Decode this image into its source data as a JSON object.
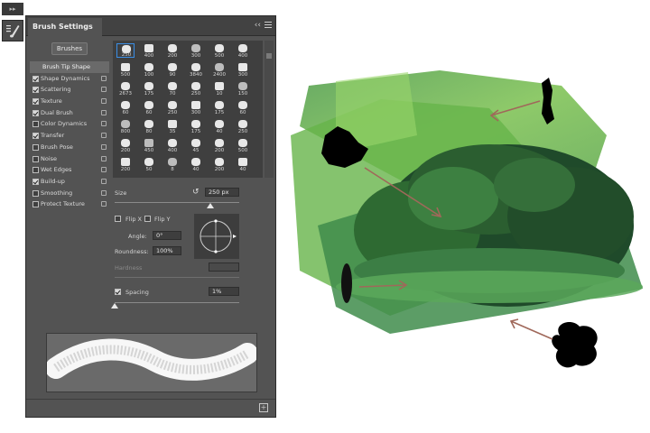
{
  "toolstrip": {
    "top_label": "▸▸",
    "brush_icon": "brush-settings-icon"
  },
  "panel": {
    "title": "Brush Settings",
    "collapse_label": "‹‹",
    "brushes_button": "Brushes"
  },
  "options": [
    {
      "label": "Brush Tip Shape",
      "checked": null,
      "lock": false,
      "head": true
    },
    {
      "label": "Shape Dynamics",
      "checked": true,
      "lock": true
    },
    {
      "label": "Scattering",
      "checked": true,
      "lock": true
    },
    {
      "label": "Texture",
      "checked": true,
      "lock": true
    },
    {
      "label": "Dual Brush",
      "checked": true,
      "lock": true
    },
    {
      "label": "Color Dynamics",
      "checked": false,
      "lock": true
    },
    {
      "label": "Transfer",
      "checked": true,
      "lock": true
    },
    {
      "label": "Brush Pose",
      "checked": false,
      "lock": true
    },
    {
      "label": "Noise",
      "checked": false,
      "lock": true
    },
    {
      "label": "Wet Edges",
      "checked": false,
      "lock": true
    },
    {
      "label": "Build-up",
      "checked": true,
      "lock": true
    },
    {
      "label": "Smoothing",
      "checked": false,
      "lock": true
    },
    {
      "label": "Protect Texture",
      "checked": false,
      "lock": true
    }
  ],
  "brush_tips": [
    "250",
    "400",
    "200",
    "300",
    "500",
    "400",
    "500",
    "100",
    "90",
    "3840",
    "2400",
    "300",
    "2673",
    "175",
    "70",
    "250",
    "10",
    "150",
    "60",
    "60",
    "250",
    "300",
    "175",
    "60",
    "800",
    "80",
    "35",
    "175",
    "40",
    "250",
    "200",
    "450",
    "400",
    "45",
    "200",
    "500",
    "200",
    "50",
    "8",
    "40",
    "200",
    "40"
  ],
  "size": {
    "label": "Size",
    "value": "250 px"
  },
  "flip_x": {
    "label": "Flip X"
  },
  "flip_y": {
    "label": "Flip Y"
  },
  "angle": {
    "label": "Angle:",
    "value": "0°"
  },
  "roundness": {
    "label": "Roundness:",
    "value": "100%"
  },
  "hardness": {
    "label": "Hardness"
  },
  "spacing": {
    "label": "Spacing",
    "value": "1%",
    "checked": true
  },
  "colors": {
    "panel_bg": "#535353",
    "selection": "#3a8ee6",
    "foliage_dark": "#1f4a2a",
    "foliage_light": "#6fbf4a",
    "arrow": "#a0685a"
  }
}
